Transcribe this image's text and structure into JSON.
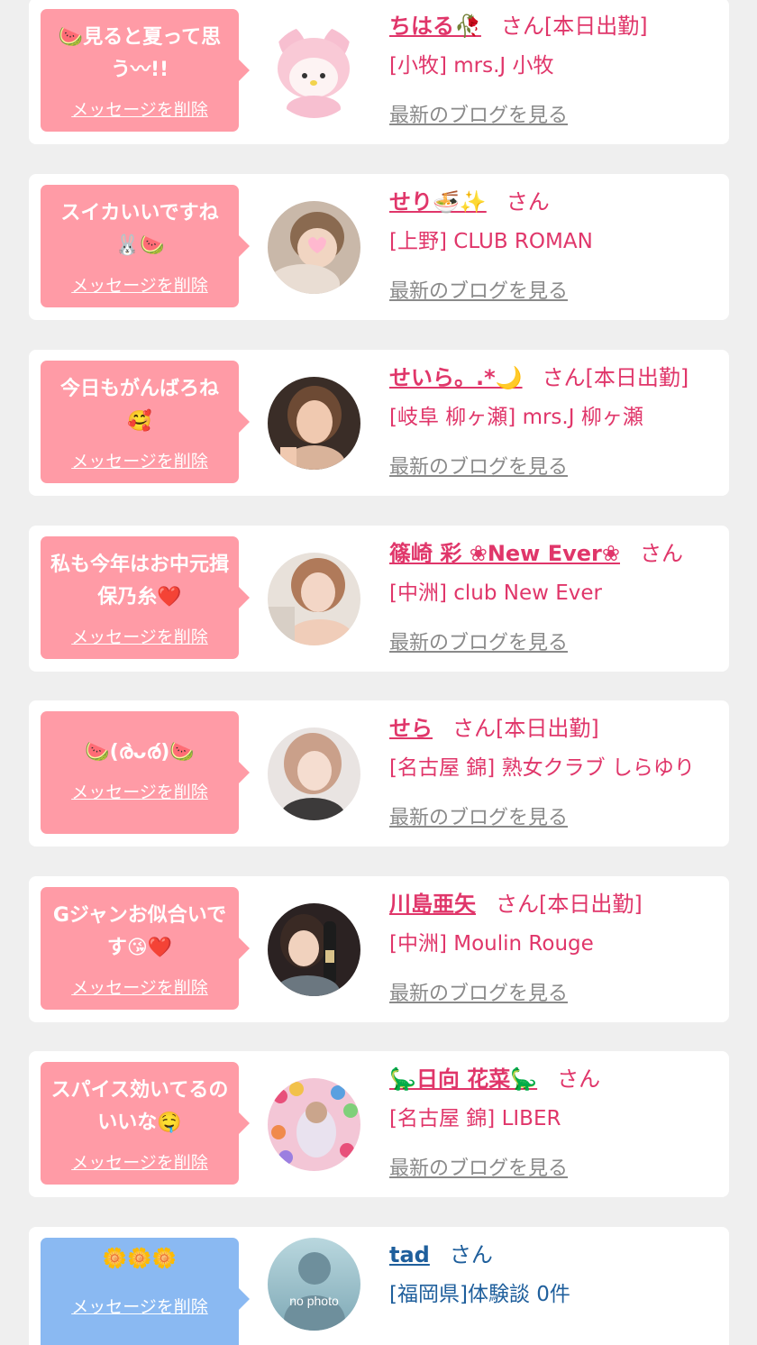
{
  "colors": {
    "pink_bubble": "#ff9ba6",
    "blue_bubble": "#8ab9f2",
    "pink_text": "#e0366a",
    "blue_text": "#1f5f9c",
    "gray_link": "#8a8a8a",
    "background": "#efefef"
  },
  "cards": [
    {
      "message": "🍉見ると夏って思う〰!!",
      "delete_label": "メッセージを削除",
      "name": "ちはる🥀",
      "san": "さん[本日出勤]",
      "shop": "[小牧] mrs.J 小牧",
      "blog_link": "最新のブログを見る",
      "avatar_icon": "my-melody-plush"
    },
    {
      "message": "スイカいいですね🐰🍉",
      "delete_label": "メッセージを削除",
      "name": "せり🍜✨",
      "san": "さん",
      "shop": "[上野] CLUB ROMAN",
      "blog_link": "最新のブログを見る",
      "avatar_icon": "profile-photo"
    },
    {
      "message": "今日もがんばろね🥰",
      "delete_label": "メッセージを削除",
      "name": "せいら。.*🌙",
      "san": "さん[本日出勤]",
      "shop": "[岐阜 柳ヶ瀬] mrs.J 柳ヶ瀬",
      "blog_link": "最新のブログを見る",
      "avatar_icon": "profile-photo"
    },
    {
      "message": "私も今年はお中元揖保乃糸❤️",
      "delete_label": "メッセージを削除",
      "name": "篠崎 彩 ❀New Ever❀",
      "san": "さん",
      "shop": "[中洲] club New Ever",
      "blog_link": "最新のブログを見る",
      "avatar_icon": "profile-photo"
    },
    {
      "message": "🍉(ര̀ᴗര́)🍉",
      "delete_label": "メッセージを削除",
      "name": "せら",
      "san": "さん[本日出勤]",
      "shop": "[名古屋 錦] 熟女クラブ しらゆり",
      "blog_link": "最新のブログを見る",
      "avatar_icon": "profile-photo"
    },
    {
      "message": "Gジャンお似合いです😘❤️",
      "delete_label": "メッセージを削除",
      "name": "川島亜矢",
      "san": "さん[本日出勤]",
      "shop": "[中洲] Moulin Rouge",
      "blog_link": "最新のブログを見る",
      "avatar_icon": "profile-photo"
    },
    {
      "message": "スパイス効いてるのいいな🤤",
      "delete_label": "メッセージを削除",
      "name": "🦕日向 花菜🦕",
      "san": "さん",
      "shop": "[名古屋 錦] LIBER",
      "blog_link": "最新のブログを見る",
      "avatar_icon": "profile-photo"
    },
    {
      "message": "🌼🌼🌼",
      "delete_label": "メッセージを削除",
      "name": "tad",
      "san": "さん",
      "shop": "[福岡県]体験談 0件",
      "avatar_icon": "no-photo",
      "avatar_text": "no photo"
    }
  ]
}
